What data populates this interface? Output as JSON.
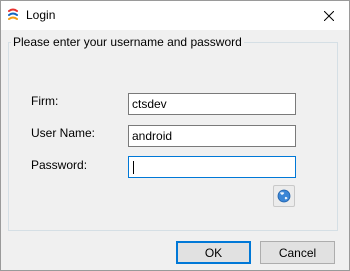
{
  "window": {
    "title": "Login",
    "app_icon": "app-logo-icon",
    "close_icon": "close-icon"
  },
  "group": {
    "caption": "Please enter your username and password"
  },
  "fields": {
    "firm": {
      "label": "Firm:",
      "value": "ctsdev"
    },
    "username": {
      "label": "User Name:",
      "value": "android"
    },
    "password": {
      "label": "Password:",
      "value": ""
    }
  },
  "buttons": {
    "ok": "OK",
    "cancel": "Cancel",
    "globe_icon": "globe-icon"
  },
  "colors": {
    "focus_border": "#0078d7",
    "logo_bar_1": "#e8312f",
    "logo_bar_2": "#1565c0",
    "logo_bar_3": "#f39c12"
  }
}
